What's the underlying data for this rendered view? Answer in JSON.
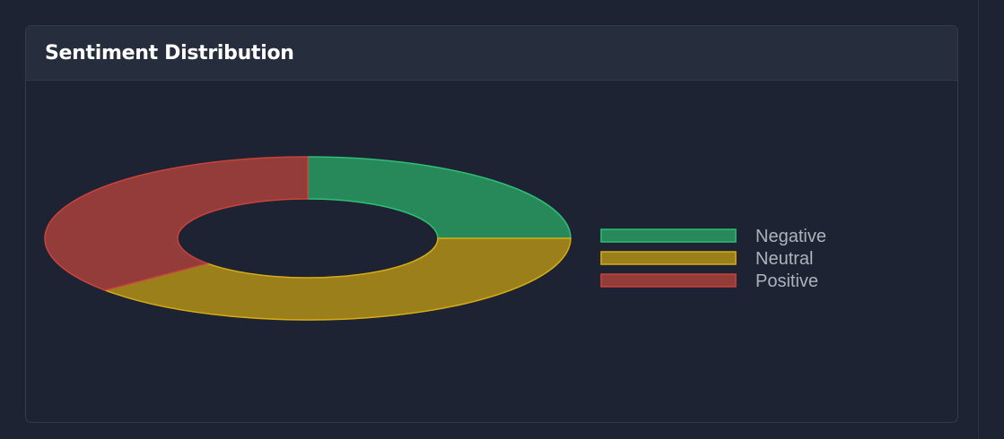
{
  "card": {
    "title": "Sentiment Distribution"
  },
  "chart_data": {
    "type": "pie",
    "variant": "doughnut",
    "title": "",
    "categories": [
      "Negative",
      "Neutral",
      "Positive"
    ],
    "values": [
      25,
      39,
      36
    ],
    "colors": [
      "#27895a",
      "#9a7f1b",
      "#943c3a"
    ],
    "border_colors": [
      "#2fbf76",
      "#d6ad17",
      "#c9433d"
    ],
    "legend_position": "right"
  }
}
